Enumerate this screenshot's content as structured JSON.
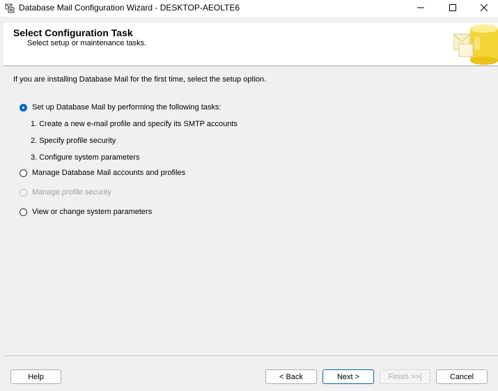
{
  "window": {
    "title": "Database Mail Configuration Wizard - DESKTOP-AEOLTE6",
    "controls": {
      "minimize_icon": "minimize-icon",
      "maximize_icon": "maximize-icon",
      "close_icon": "close-icon"
    }
  },
  "header": {
    "title": "Select Configuration Task",
    "subtitle": "Select setup or maintenance tasks."
  },
  "body": {
    "intro": "If you are installing Database Mail for the first time, select the setup option.",
    "options": [
      {
        "label": "Set up Database Mail by performing the following tasks:",
        "selected": true,
        "enabled": true
      },
      {
        "label": "Manage Database Mail accounts and profiles",
        "selected": false,
        "enabled": true
      },
      {
        "label": "Manage profile security",
        "selected": false,
        "enabled": false
      },
      {
        "label": "View or change system parameters",
        "selected": false,
        "enabled": true
      }
    ],
    "setup_tasks": [
      "1. Create a new e-mail profile and specify its SMTP accounts",
      "2. Specify profile security",
      "3. Configure system parameters"
    ]
  },
  "buttons": {
    "help": "Help",
    "back": "< Back",
    "next": "Next >",
    "finish": "Finish >>|",
    "cancel": "Cancel"
  },
  "colors": {
    "accent": "#0067c0",
    "window_bg": "#f0f0f0",
    "disabled_text": "#a0a0a0"
  }
}
